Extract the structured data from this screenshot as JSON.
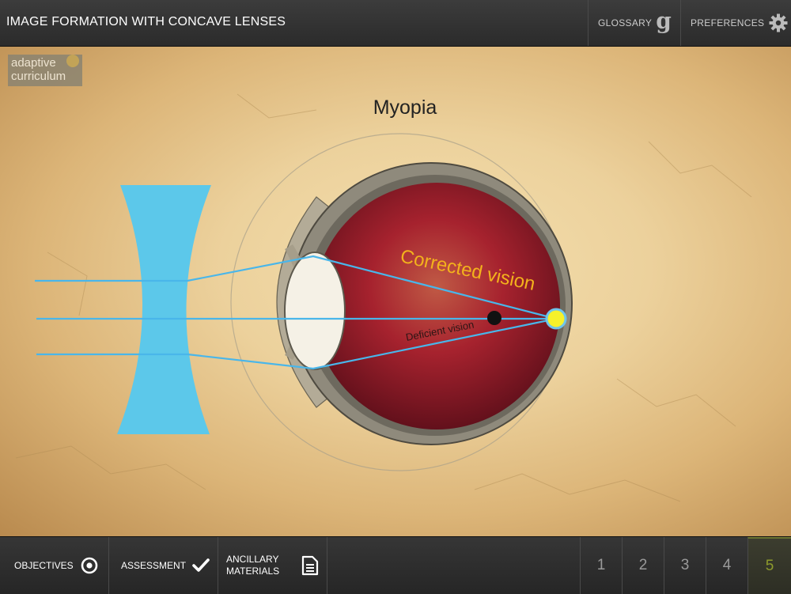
{
  "header": {
    "title": "IMAGE FORMATION WITH CONCAVE LENSES",
    "glossary_label": "GLOSSARY",
    "glossary_glyph": "g",
    "preferences_label": "PREFERENCES"
  },
  "logo": {
    "line1": "adaptive",
    "line2": "curriculum"
  },
  "diagram": {
    "title": "Myopia",
    "corrected_label": "Corrected vision",
    "deficient_label": "Deficient vision",
    "colors": {
      "lens": "#5cc8ea",
      "ray": "#49b6ea",
      "corrected_text": "#f3b21c",
      "focus": "#f6f12a",
      "eyeball": "#8f8a7c",
      "retina_inner": "#a6222e"
    }
  },
  "footer": {
    "objectives_label": "OBJECTIVES",
    "assessment_label": "ASSESSMENT",
    "ancillary_line1": "ANCILLARY",
    "ancillary_line2": "MATERIALS",
    "pages": [
      "1",
      "2",
      "3",
      "4",
      "5"
    ],
    "active_page": "5"
  }
}
